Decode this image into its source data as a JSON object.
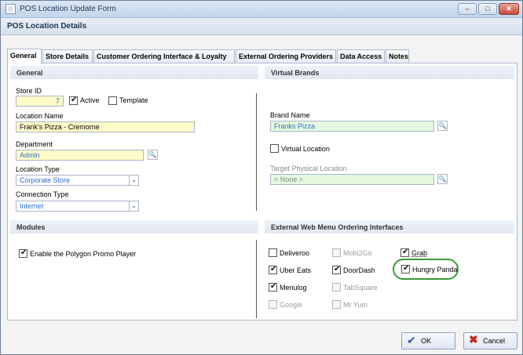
{
  "window": {
    "title": "POS Location Update Form",
    "btn_min": "–",
    "btn_restore": "□",
    "btn_close": "✕"
  },
  "header": {
    "title": "POS Location Details"
  },
  "tabs": [
    {
      "label": "General"
    },
    {
      "label": "Store Details"
    },
    {
      "label": "Customer Ordering Interface & Loyalty"
    },
    {
      "label": "External Ordering Providers"
    },
    {
      "label": "Data Access"
    },
    {
      "label": "Notes"
    }
  ],
  "general": {
    "section_title": "General",
    "store_id_label": "Store ID",
    "store_id_value": "7",
    "active_label": "Active",
    "active_checked": true,
    "template_label": "Template",
    "template_checked": false,
    "location_name_label": "Location Name",
    "location_name_value": "Frank's Pizza - Cremorne",
    "department_label": "Department",
    "department_value": "Admin",
    "location_type_label": "Location Type",
    "location_type_value": "Corporate Store",
    "connection_type_label": "Connection Type",
    "connection_type_value": "Internet"
  },
  "virtual_brands": {
    "section_title": "Virtual Brands",
    "brand_name_label": "Brand Name",
    "brand_name_value": "Franks Pizza",
    "virtual_location_label": "Virtual Location",
    "target_physical_label": "Target Physical Location",
    "target_physical_value": "< None >"
  },
  "modules": {
    "section_title": "Modules",
    "promo_player_label": "Enable the Polygon Promo Player"
  },
  "external_web": {
    "section_title": "External Web Menu Ordering Interfaces",
    "options": [
      {
        "label": "Deliveroo",
        "checked": false,
        "enabled": true
      },
      {
        "label": "Mobi2Go",
        "checked": false,
        "enabled": false
      },
      {
        "label": "Grab",
        "checked": true,
        "enabled": true
      },
      {
        "label": "Uber Eats",
        "checked": true,
        "enabled": true
      },
      {
        "label": "DoorDash",
        "checked": true,
        "enabled": true
      },
      {
        "label": "Hungry Panda",
        "checked": true,
        "enabled": true
      },
      {
        "label": "Menulog",
        "checked": true,
        "enabled": true
      },
      {
        "label": "TabSquare",
        "checked": false,
        "enabled": false
      },
      {
        "label": "Google",
        "checked": false,
        "enabled": false
      },
      {
        "label": "Mr Yum",
        "checked": false,
        "enabled": false
      }
    ]
  },
  "footer": {
    "ok_label": "OK",
    "cancel_label": "Cancel"
  }
}
